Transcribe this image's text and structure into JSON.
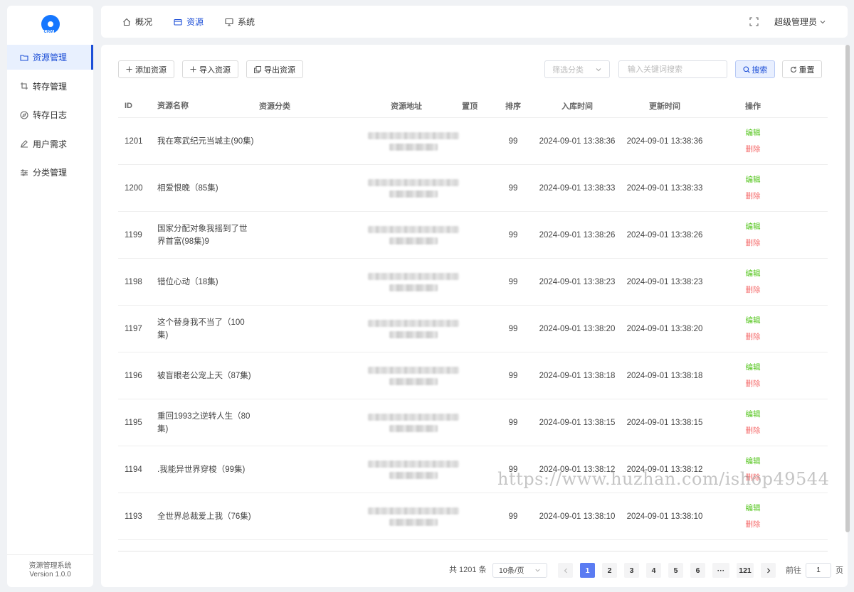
{
  "app": {
    "brand_text": "CRM",
    "footer_name": "资源管理系统",
    "footer_version": "Version 1.0.0"
  },
  "sidebar": {
    "items": [
      {
        "label": "资源管理",
        "icon": "folder-icon",
        "active": true
      },
      {
        "label": "转存管理",
        "icon": "crop-icon",
        "active": false
      },
      {
        "label": "转存日志",
        "icon": "compass-icon",
        "active": false
      },
      {
        "label": "用户需求",
        "icon": "pen-icon",
        "active": false
      },
      {
        "label": "分类管理",
        "icon": "sliders-icon",
        "active": false
      }
    ]
  },
  "topnav": {
    "items": [
      {
        "label": "概况",
        "icon": "home-icon",
        "active": false
      },
      {
        "label": "资源",
        "icon": "box-icon",
        "active": true
      },
      {
        "label": "系统",
        "icon": "monitor-icon",
        "active": false
      }
    ],
    "user": "超级管理员"
  },
  "toolbar": {
    "add": "添加资源",
    "import": "导入资源",
    "export": "导出资源"
  },
  "filters": {
    "category_placeholder": "筛选分类",
    "search_placeholder": "输入关键词搜索",
    "search_label": "搜索",
    "reset_label": "重置"
  },
  "table": {
    "columns": {
      "id": "ID",
      "name": "资源名称",
      "category": "资源分类",
      "url": "资源地址",
      "pinned": "置顶",
      "sort": "排序",
      "created": "入库时间",
      "updated": "更新时间",
      "actions": "操作"
    },
    "edit_label": "编辑",
    "delete_label": "删除",
    "rows": [
      {
        "id": "1201",
        "name": "我在寒武纪元当城主(90集)",
        "sort": "99",
        "created": "2024-09-01 13:38:36",
        "updated": "2024-09-01 13:38:36"
      },
      {
        "id": "1200",
        "name": "相爱恨晚（85集)",
        "sort": "99",
        "created": "2024-09-01 13:38:33",
        "updated": "2024-09-01 13:38:33"
      },
      {
        "id": "1199",
        "name": "国家分配对象我摇到了世界首富(98集)9",
        "sort": "99",
        "created": "2024-09-01 13:38:26",
        "updated": "2024-09-01 13:38:26"
      },
      {
        "id": "1198",
        "name": "错位心动（18集)",
        "sort": "99",
        "created": "2024-09-01 13:38:23",
        "updated": "2024-09-01 13:38:23"
      },
      {
        "id": "1197",
        "name": "这个替身我不当了（100集)",
        "sort": "99",
        "created": "2024-09-01 13:38:20",
        "updated": "2024-09-01 13:38:20"
      },
      {
        "id": "1196",
        "name": "被盲眼老公宠上天（87集)",
        "sort": "99",
        "created": "2024-09-01 13:38:18",
        "updated": "2024-09-01 13:38:18"
      },
      {
        "id": "1195",
        "name": "重回1993之逆转人生（80集)",
        "sort": "99",
        "created": "2024-09-01 13:38:15",
        "updated": "2024-09-01 13:38:15"
      },
      {
        "id": "1194",
        "name": ".我能异世界穿梭（99集)",
        "sort": "99",
        "created": "2024-09-01 13:38:12",
        "updated": "2024-09-01 13:38:12"
      },
      {
        "id": "1193",
        "name": "全世界总裁爱上我（76集)",
        "sort": "99",
        "created": "2024-09-01 13:38:10",
        "updated": "2024-09-01 13:38:10"
      }
    ]
  },
  "pagination": {
    "total": "共 1201 条",
    "page_size": "10条/页",
    "pages": [
      "1",
      "2",
      "3",
      "4",
      "5",
      "6",
      "···",
      "121"
    ],
    "current": "1",
    "goto_prefix": "前往",
    "goto_value": "1",
    "goto_suffix": "页"
  },
  "watermark": "https://www.huzhan.com/ishop49544",
  "colors": {
    "accent": "#1d4fd7",
    "edit": "#52c41a",
    "delete": "#f56c6c",
    "page_active": "#5b7cf2"
  }
}
